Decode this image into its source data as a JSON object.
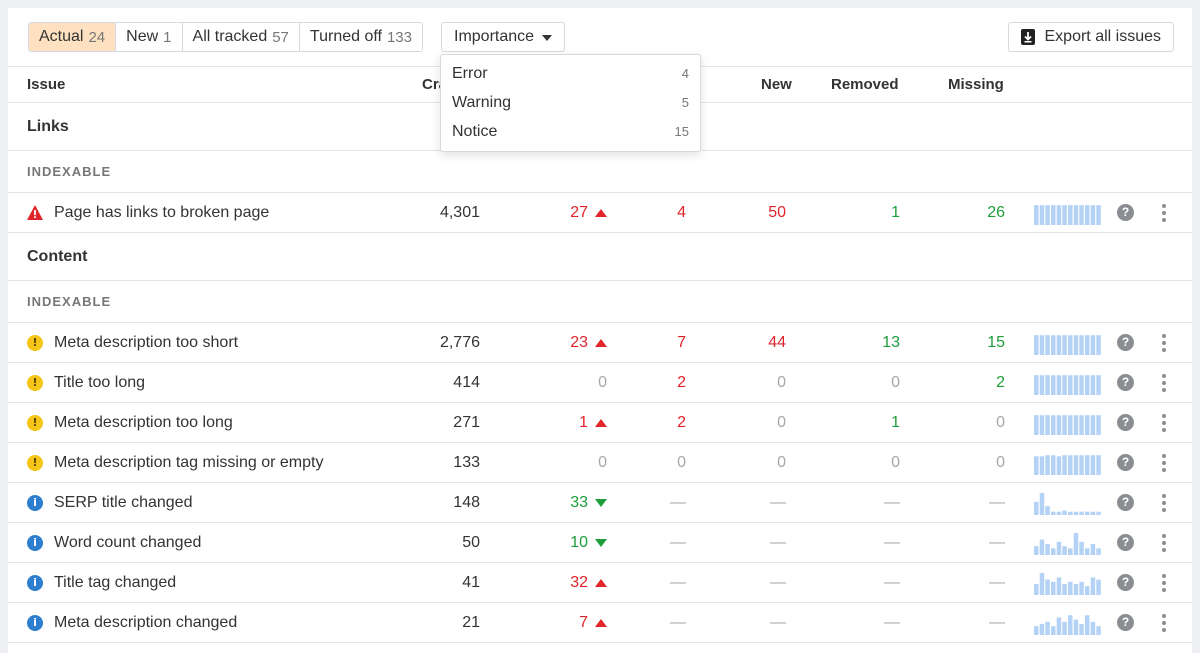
{
  "filters": {
    "tabs": [
      {
        "label": "Actual",
        "count": "24",
        "active": true
      },
      {
        "label": "New",
        "count": "1"
      },
      {
        "label": "All tracked",
        "count": "57"
      },
      {
        "label": "Turned off",
        "count": "133"
      }
    ],
    "importance_label": "Importance",
    "export_label": "Export all issues"
  },
  "dropdown": {
    "items": [
      {
        "label": "Error",
        "count": "4"
      },
      {
        "label": "Warning",
        "count": "5"
      },
      {
        "label": "Notice",
        "count": "15"
      }
    ]
  },
  "table": {
    "headers": {
      "issue": "Issue",
      "crawled": "Cra",
      "new": "New",
      "removed": "Removed",
      "missing": "Missing"
    },
    "sections": [
      {
        "title": "Links",
        "subheader": "INDEXABLE",
        "rows": [
          {
            "icon": "error-triangle-icon",
            "name": "Page has links to broken page",
            "crawled": "4,301",
            "change": "27",
            "change_dir": "up",
            "change_color": "red",
            "added": "4",
            "added_color": "red",
            "new": "50",
            "new_color": "red",
            "removed": "1",
            "removed_color": "green",
            "missing": "26",
            "missing_color": "green",
            "spark": [
              0.9,
              0.9,
              0.9,
              0.9,
              0.9,
              0.9,
              0.9,
              0.9,
              0.9,
              0.9,
              0.9,
              0.9
            ]
          }
        ]
      },
      {
        "title": "Content",
        "subheader": "INDEXABLE",
        "rows": [
          {
            "icon": "warning-icon",
            "name": "Meta description too short",
            "crawled": "2,776",
            "change": "23",
            "change_dir": "up",
            "change_color": "red",
            "added": "7",
            "added_color": "red",
            "new": "44",
            "new_color": "red",
            "removed": "13",
            "removed_color": "green",
            "missing": "15",
            "missing_color": "green",
            "spark": [
              0.9,
              0.9,
              0.9,
              0.9,
              0.9,
              0.9,
              0.9,
              0.9,
              0.9,
              0.9,
              0.9,
              0.9
            ]
          },
          {
            "icon": "warning-icon",
            "name": "Title too long",
            "crawled": "414",
            "change": "0",
            "change_dir": "none",
            "change_color": "grey",
            "added": "2",
            "added_color": "red",
            "new": "0",
            "new_color": "grey",
            "removed": "0",
            "removed_color": "grey",
            "missing": "2",
            "missing_color": "green",
            "spark": [
              0.9,
              0.9,
              0.9,
              0.9,
              0.9,
              0.9,
              0.9,
              0.9,
              0.9,
              0.9,
              0.9,
              0.9
            ]
          },
          {
            "icon": "warning-icon",
            "name": "Meta description too long",
            "crawled": "271",
            "change": "1",
            "change_dir": "up",
            "change_color": "red",
            "added": "2",
            "added_color": "red",
            "new": "0",
            "new_color": "grey",
            "removed": "1",
            "removed_color": "green",
            "missing": "0",
            "missing_color": "grey",
            "spark": [
              0.9,
              0.9,
              0.9,
              0.9,
              0.9,
              0.9,
              0.9,
              0.9,
              0.9,
              0.9,
              0.9,
              0.9
            ]
          },
          {
            "icon": "warning-icon",
            "name": "Meta description tag missing or empty",
            "crawled": "133",
            "change": "0",
            "change_dir": "none",
            "change_color": "grey",
            "added": "0",
            "added_color": "grey",
            "new": "0",
            "new_color": "grey",
            "removed": "0",
            "removed_color": "grey",
            "missing": "0",
            "missing_color": "grey",
            "spark": [
              0.85,
              0.85,
              0.9,
              0.9,
              0.85,
              0.9,
              0.9,
              0.9,
              0.9,
              0.9,
              0.9,
              0.9
            ]
          },
          {
            "icon": "info-icon",
            "name": "SERP title changed",
            "crawled": "148",
            "change": "33",
            "change_dir": "down",
            "change_color": "green",
            "added": "—",
            "added_color": "grey",
            "new": "—",
            "new_color": "grey",
            "removed": "—",
            "removed_color": "grey",
            "missing": "—",
            "missing_color": "grey",
            "spark": [
              0.6,
              1.0,
              0.4,
              0.15,
              0.15,
              0.2,
              0.15,
              0.15,
              0.15,
              0.15,
              0.15,
              0.15
            ]
          },
          {
            "icon": "info-icon",
            "name": "Word count changed",
            "crawled": "50",
            "change": "10",
            "change_dir": "down",
            "change_color": "green",
            "added": "—",
            "added_color": "grey",
            "new": "—",
            "new_color": "grey",
            "removed": "—",
            "removed_color": "grey",
            "missing": "—",
            "missing_color": "grey",
            "spark": [
              0.4,
              0.7,
              0.5,
              0.3,
              0.6,
              0.4,
              0.3,
              1.0,
              0.6,
              0.3,
              0.5,
              0.3
            ]
          },
          {
            "icon": "info-icon",
            "name": "Title tag changed",
            "crawled": "41",
            "change": "32",
            "change_dir": "up",
            "change_color": "red",
            "added": "—",
            "added_color": "grey",
            "new": "—",
            "new_color": "grey",
            "removed": "—",
            "removed_color": "grey",
            "missing": "—",
            "missing_color": "grey",
            "spark": [
              0.5,
              1.0,
              0.7,
              0.6,
              0.8,
              0.5,
              0.6,
              0.5,
              0.6,
              0.4,
              0.8,
              0.7
            ]
          },
          {
            "icon": "info-icon",
            "name": "Meta description changed",
            "crawled": "21",
            "change": "7",
            "change_dir": "up",
            "change_color": "red",
            "added": "—",
            "added_color": "grey",
            "new": "—",
            "new_color": "grey",
            "removed": "—",
            "removed_color": "grey",
            "missing": "—",
            "missing_color": "grey",
            "spark": [
              0.4,
              0.5,
              0.6,
              0.4,
              0.8,
              0.6,
              0.9,
              0.7,
              0.5,
              0.9,
              0.6,
              0.4
            ]
          }
        ]
      }
    ]
  },
  "colors": {
    "active_tab": "#fde1c1",
    "red": "#e0242a",
    "green": "#1e9e3a",
    "spark": "#b3d2f5",
    "warning": "#f5c518",
    "info": "#2f7fd0"
  }
}
